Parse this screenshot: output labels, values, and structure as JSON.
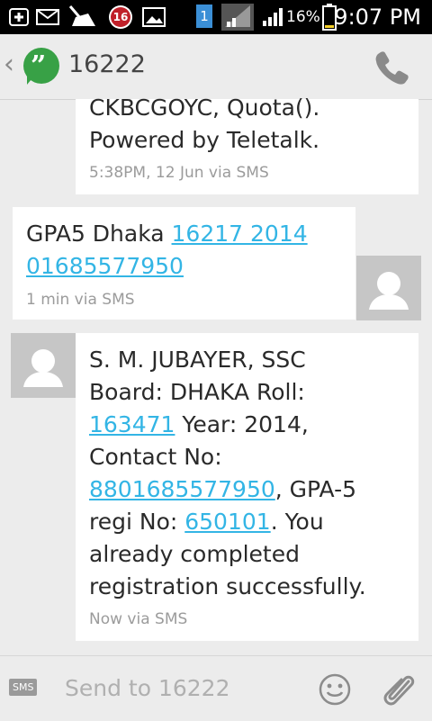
{
  "status_bar": {
    "notification_count": "16",
    "sim_slot": "1",
    "battery_pct": "16%",
    "time": "9:07 PM"
  },
  "header": {
    "back_glyph": "‹",
    "app_icon": "hangouts-icon",
    "title": "16222",
    "call_icon": "phone-icon"
  },
  "messages": [
    {
      "direction": "incoming",
      "lines": [
        "CKBCGOYC, Quota().",
        "Powered by Teletalk."
      ],
      "meta": "5:38PM, 12 Jun via SMS"
    },
    {
      "direction": "outgoing",
      "line1_prefix": "GPA5 Dhaka ",
      "line1_link": "16217  2014",
      "line2_link": "01685577950",
      "meta": "1 min via SMS"
    },
    {
      "direction": "incoming",
      "line1": "S. M. JUBAYER, SSC",
      "line2": "Board: DHAKA Roll:",
      "line3_link": "163471",
      "line3_rest": " Year: 2014,",
      "line4": "Contact No:",
      "line5_link": "8801685577950",
      "line5_rest": ", GPA-5",
      "line6_prefix": "regi No: ",
      "line6_link": "650101",
      "line6_rest": ". You",
      "line7": "already completed",
      "line8": "registration successfully.",
      "meta": "Now via SMS"
    }
  ],
  "composer": {
    "sms_badge": "SMS",
    "placeholder": "Send to 16222",
    "emoji_icon": "smiley-icon",
    "attach_icon": "paperclip-icon"
  }
}
